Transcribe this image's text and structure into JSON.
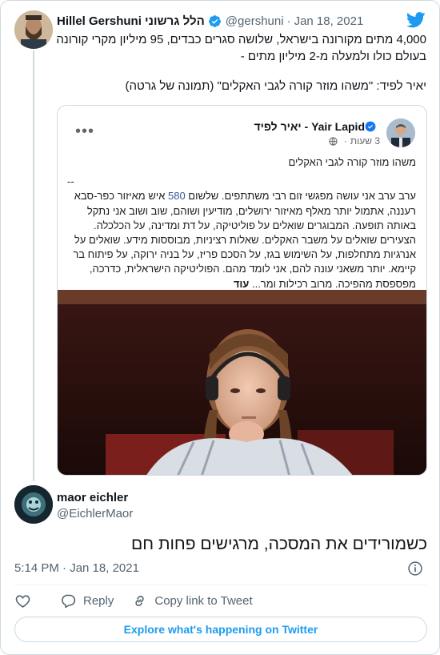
{
  "colors": {
    "twitter_blue": "#1d9bf0",
    "secondary_text": "#536471",
    "border": "#cfd9de",
    "facebook_link": "#385898"
  },
  "parent_tweet": {
    "display_name": "Hillel Gershuni הלל גרשוני",
    "handle": "@gershuni",
    "separator": "·",
    "date": "Jan 18, 2021",
    "text_lines": [
      "4,000 מתים מקורונה בישראל, שלושה סגרים כבדים, 95 מיליון מקרי קורונה",
      "בעולם כולו ולמעלה מ-2 מיליון מתים -",
      "יאיר לפיד: \"משהו מוזר קורה לגבי האקלים\" (תמונה של גרטה)"
    ],
    "icons": {
      "avatar": "avatar-photo",
      "verified": "verified-badge-icon",
      "brand": "twitter-bird-icon"
    }
  },
  "embedded_post": {
    "author": "יאיר לפיד - Yair Lapid",
    "time": "3 שעות",
    "separator": "·",
    "headline": "משהו מוזר קורה לגבי האקלים",
    "dashes": "--",
    "body_lines": [
      {
        "pre": "ערב ערב אני עושה מפגשי זום רבי משתתפים. שלשום ",
        "num": "580",
        "post": " איש מאיזור כפר-סבא"
      },
      {
        "pre": "רעננה, אתמול יותר מאלף מאיזור ירושלים, מודיעין ושוהם, שוב ושוב אני נתקל",
        "num": "",
        "post": ""
      },
      {
        "pre": "באותה תופעה. המבוגרים שואלים על פוליטיקה, על דת ומדינה, על הכלכלה.",
        "num": "",
        "post": ""
      },
      {
        "pre": "הצעירים שואלים על משבר האקלים. שאלות רציניות, מבוססות מידע. שואלים על",
        "num": "",
        "post": ""
      },
      {
        "pre": "אנרגיות מתחלפות, על השימוש בגז, על הסכם פריז, על בניה ירוקה, על פיתוח בר",
        "num": "",
        "post": ""
      },
      {
        "pre": "קיימא. יותר משאני עונה להם, אני לומד מהם. הפוליטיקה הישראלית, כדרכה,",
        "num": "",
        "post": ""
      }
    ],
    "last_line": "מפספסת מהפיכה. מרוב רכילות ומר...",
    "more": "עוד",
    "icons": {
      "verified": "verified-badge-icon",
      "globe": "globe-icon",
      "more": "more-options-icon"
    }
  },
  "main_tweet": {
    "display_name": "maor eichler",
    "handle": "@EichlerMaor",
    "text": "כשמורידים את המסכה, מרגישים פחות חם",
    "timestamp": "5:14 PM · Jan 18, 2021"
  },
  "actions": {
    "like_label": "",
    "reply_label": "Reply",
    "copy_label": "Copy link to Tweet"
  },
  "explore_label": "Explore what's happening on Twitter"
}
